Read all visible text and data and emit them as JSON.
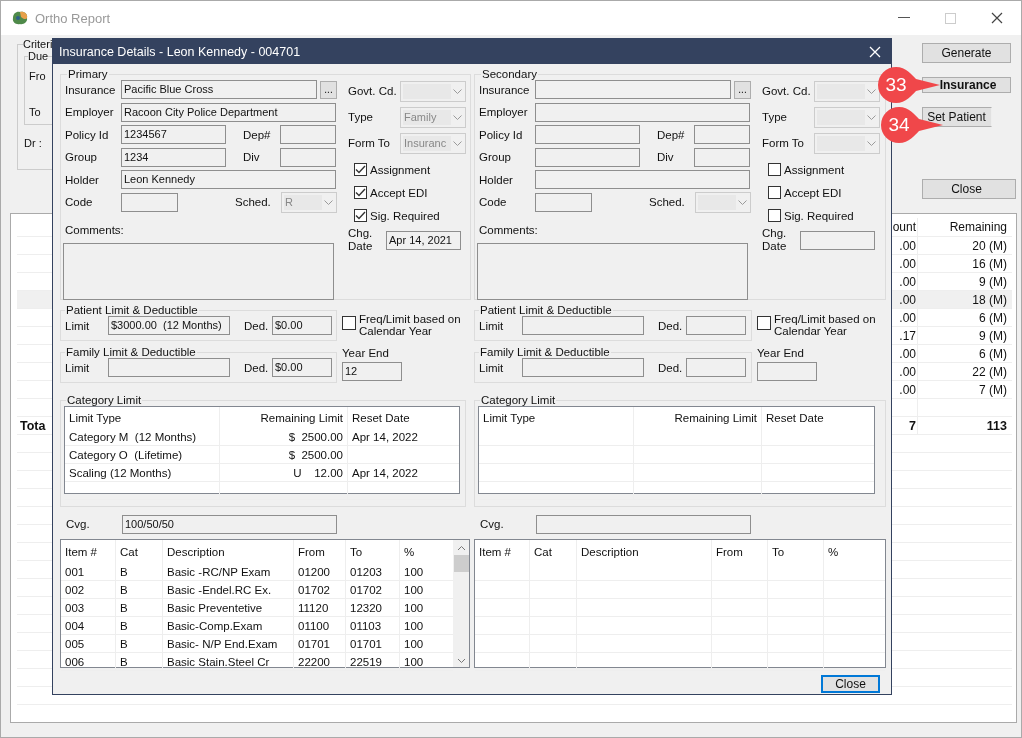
{
  "background_window": {
    "title": "Ortho Report",
    "criteria": {
      "caption": "Criteri",
      "sub_caption": "Due",
      "from_label": "Fro",
      "to_label": "To",
      "dr_label": "Dr :"
    },
    "buttons": [
      {
        "label": "Generate"
      },
      {
        "label": "Insurance"
      },
      {
        "label": "Set Patient"
      },
      {
        "label": "Close"
      }
    ],
    "table": {
      "columns": [
        "ount",
        "Remaining"
      ],
      "rows": [
        {
          "amount": ".00",
          "remaining": "20 (M)",
          "selected": false
        },
        {
          "amount": ".00",
          "remaining": "16 (M)",
          "selected": false
        },
        {
          "amount": ".00",
          "remaining": "9 (M)",
          "selected": false
        },
        {
          "amount": ".00",
          "remaining": "18 (M)",
          "selected": true
        },
        {
          "amount": ".00",
          "remaining": "6 (M)",
          "selected": false
        },
        {
          "amount": ".17",
          "remaining": "9 (M)",
          "selected": false
        },
        {
          "amount": ".00",
          "remaining": "6 (M)",
          "selected": false
        },
        {
          "amount": ".00",
          "remaining": "22 (M)",
          "selected": false
        },
        {
          "amount": ".00",
          "remaining": "7 (M)",
          "selected": false
        }
      ],
      "total": {
        "label": "Tota",
        "amount": "7",
        "remaining": "113"
      }
    }
  },
  "callouts": [
    {
      "number": "33"
    },
    {
      "number": "34"
    }
  ],
  "dialog": {
    "title": "Insurance Details - Leon Kennedy - 004701",
    "panels": [
      {
        "caption": "Primary",
        "insurance": {
          "label": "Insurance",
          "value": "Pacific Blue Cross"
        },
        "browse_button": "...",
        "employer": {
          "label": "Employer",
          "value": "Racoon City Police Department"
        },
        "policy_id": {
          "label": "Policy Id",
          "value": "1234567"
        },
        "dep": {
          "label": "Dep#"
        },
        "group": {
          "label": "Group",
          "value": "1234"
        },
        "div": {
          "label": "Div"
        },
        "holder": {
          "label": "Holder",
          "value": "Leon Kennedy"
        },
        "code": {
          "label": "Code"
        },
        "sched": {
          "label": "Sched.",
          "value": "R"
        },
        "comments": {
          "label": "Comments:"
        },
        "govt_cd": {
          "label": "Govt. Cd."
        },
        "type": {
          "label": "Type",
          "value": "Family"
        },
        "form_to": {
          "label": "Form To",
          "value": "Insuranc"
        },
        "checks": [
          {
            "label": "Assignment",
            "checked": true
          },
          {
            "label": "Accept EDI",
            "checked": true
          },
          {
            "label": "Sig. Required",
            "checked": true
          }
        ],
        "chg_date": {
          "label": "Chg. Date",
          "value": "Apr 14, 2021"
        },
        "patient_limit": {
          "caption": "Patient Limit & Deductible",
          "limit_label": "Limit",
          "limit": "$3000.00  (12 Months)",
          "ded_label": "Ded.",
          "ded": "$0.00"
        },
        "freq_calendar": {
          "label": "Freq/Limit based on Calendar Year",
          "checked": false
        },
        "family_limit": {
          "caption": "Family Limit & Deductible",
          "limit_label": "Limit",
          "ded_label": "Ded.",
          "ded": "$0.00"
        },
        "year_end": {
          "label": "Year End",
          "value": "12"
        },
        "category_limit": {
          "caption": "Category Limit",
          "columns": [
            "Limit Type",
            "Remaining Limit",
            "Reset Date"
          ],
          "rows": [
            [
              "Category M  (12 Months)",
              "$  2500.00",
              "Apr 14, 2022"
            ],
            [
              "Category O  (Lifetime)",
              "$  2500.00",
              null
            ],
            [
              "Scaling (12 Months)",
              "U    12.00",
              "Apr 14, 2022"
            ]
          ]
        },
        "cvg": {
          "label": "Cvg.",
          "value": "100/50/50"
        },
        "items": {
          "columns": [
            "Item #",
            "Cat",
            "Description",
            "From",
            "To",
            "%"
          ],
          "rows": [
            [
              "001",
              "B",
              "Basic -RC/NP Exam",
              "01200",
              "01203",
              "100"
            ],
            [
              "002",
              "B",
              "Basic -Endel.RC Ex.",
              "01702",
              "01702",
              "100"
            ],
            [
              "003",
              "B",
              "Basic Preventetive",
              "11120",
              "12320",
              "100"
            ],
            [
              "004",
              "B",
              "Basic-Comp.Exam",
              "01100",
              "01103",
              "100"
            ],
            [
              "005",
              "B",
              "Basic- N/P End.Exam",
              "01701",
              "01701",
              "100"
            ],
            [
              "006",
              "B",
              "Basic Stain.Steel Cr",
              "22200",
              "22519",
              "100"
            ]
          ]
        }
      },
      {
        "caption": "Secondary",
        "insurance": {
          "label": "Insurance"
        },
        "browse_button": "...",
        "employer": {
          "label": "Employer"
        },
        "policy_id": {
          "label": "Policy Id"
        },
        "dep": {
          "label": "Dep#"
        },
        "group": {
          "label": "Group"
        },
        "div": {
          "label": "Div"
        },
        "holder": {
          "label": "Holder"
        },
        "code": {
          "label": "Code"
        },
        "sched": {
          "label": "Sched."
        },
        "comments": {
          "label": "Comments:"
        },
        "govt_cd": {
          "label": "Govt. Cd."
        },
        "type": {
          "label": "Type"
        },
        "form_to": {
          "label": "Form To"
        },
        "checks": [
          {
            "label": "Assignment",
            "checked": false
          },
          {
            "label": "Accept EDI",
            "checked": false
          },
          {
            "label": "Sig. Required",
            "checked": false
          }
        ],
        "chg_date": {
          "label": "Chg. Date"
        },
        "patient_limit": {
          "caption": "Patient Limit & Deductible",
          "limit_label": "Limit",
          "ded_label": "Ded."
        },
        "freq_calendar": {
          "label": "Freq/Limit based on Calendar Year",
          "checked": false
        },
        "family_limit": {
          "caption": "Family Limit & Deductible",
          "limit_label": "Limit",
          "ded_label": "Ded."
        },
        "year_end": {
          "label": "Year End"
        },
        "category_limit": {
          "caption": "Category Limit",
          "columns": [
            "Limit Type",
            "Remaining Limit",
            "Reset Date"
          ]
        },
        "cvg": {
          "label": "Cvg."
        },
        "items": {
          "columns": [
            "Item #",
            "Cat",
            "Description",
            "From",
            "To",
            "%"
          ]
        }
      }
    ],
    "close_button": "Close"
  }
}
